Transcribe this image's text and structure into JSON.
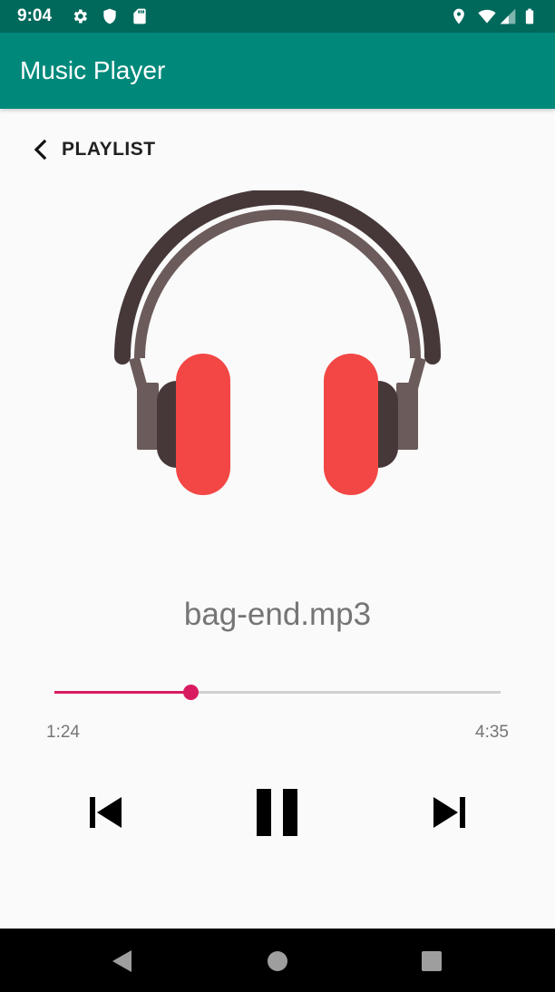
{
  "status_bar": {
    "time": "9:04",
    "icons": [
      "settings-icon",
      "shield-icon",
      "sd-card-icon",
      "location-icon",
      "wifi-icon",
      "signal-icon",
      "battery-icon"
    ]
  },
  "app_bar": {
    "title": "Music Player",
    "background": "#00897B"
  },
  "back": {
    "label": "PLAYLIST",
    "icon": "chevron-left-icon"
  },
  "album_art": {
    "icon": "headphones-icon"
  },
  "player": {
    "track_name": "bag-end.mp3",
    "elapsed": "1:24",
    "duration": "4:35",
    "progress": 0.305,
    "accent": "#D81B60"
  },
  "controls": {
    "previous": "skip-previous-icon",
    "play_pause": "pause-icon",
    "next": "skip-next-icon"
  },
  "nav_bar": {
    "back": "nav-back-icon",
    "home": "nav-home-icon",
    "recents": "nav-recents-icon"
  }
}
